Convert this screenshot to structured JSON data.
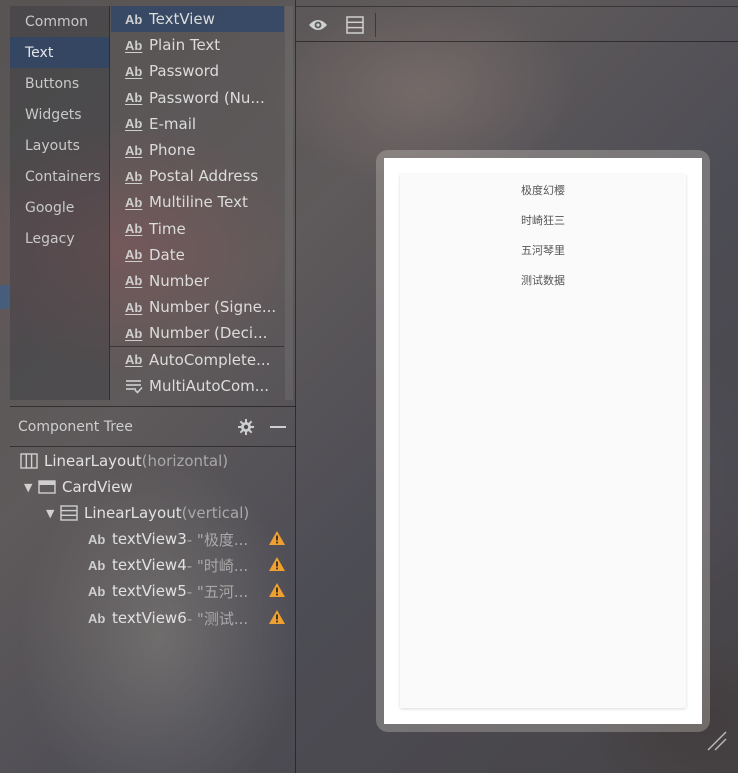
{
  "palette": {
    "categories": [
      {
        "label": "Common",
        "selected": false
      },
      {
        "label": "Text",
        "selected": true
      },
      {
        "label": "Buttons",
        "selected": false
      },
      {
        "label": "Widgets",
        "selected": false
      },
      {
        "label": "Layouts",
        "selected": false
      },
      {
        "label": "Containers",
        "selected": false
      },
      {
        "label": "Google",
        "selected": false
      },
      {
        "label": "Legacy",
        "selected": false
      }
    ],
    "widgets": [
      {
        "icon": "Ab",
        "label": "TextView",
        "selected": true
      },
      {
        "icon": "Ab",
        "label": "Plain Text"
      },
      {
        "icon": "Ab",
        "label": "Password"
      },
      {
        "icon": "Ab",
        "label": "Password (Nu..."
      },
      {
        "icon": "Ab",
        "label": "E-mail"
      },
      {
        "icon": "Ab",
        "label": "Phone"
      },
      {
        "icon": "Ab",
        "label": "Postal Address"
      },
      {
        "icon": "Ab",
        "label": "Multiline Text"
      },
      {
        "icon": "Ab",
        "label": "Time"
      },
      {
        "icon": "Ab",
        "label": "Date"
      },
      {
        "icon": "Ab",
        "label": "Number"
      },
      {
        "icon": "Ab",
        "label": "Number (Signe..."
      },
      {
        "icon": "Ab",
        "label": "Number (Deci..."
      },
      {
        "icon": "Ab",
        "label": "AutoComplete..."
      },
      {
        "icon": "Ab",
        "label": "MultiAutoCom..."
      }
    ]
  },
  "component_tree": {
    "title": "Component Tree",
    "nodes": [
      {
        "name": "LinearLayout",
        "sub": "(horizontal)"
      },
      {
        "name": "CardView",
        "sub": ""
      },
      {
        "name": "LinearLayout",
        "sub": "(vertical)"
      },
      {
        "name": "textView3",
        "sub": "- \"极度..."
      },
      {
        "name": "textView4",
        "sub": "- \"时崎..."
      },
      {
        "name": "textView5",
        "sub": "- \"五河..."
      },
      {
        "name": "textView6",
        "sub": "- \"测试..."
      }
    ]
  },
  "preview": {
    "texts": [
      "极度幻樱",
      "时崎狂三",
      "五河琴里",
      "测试数据"
    ]
  },
  "colors": {
    "selection": "#2c4669",
    "warning": "#f0a030",
    "screen": "#ffffff"
  }
}
